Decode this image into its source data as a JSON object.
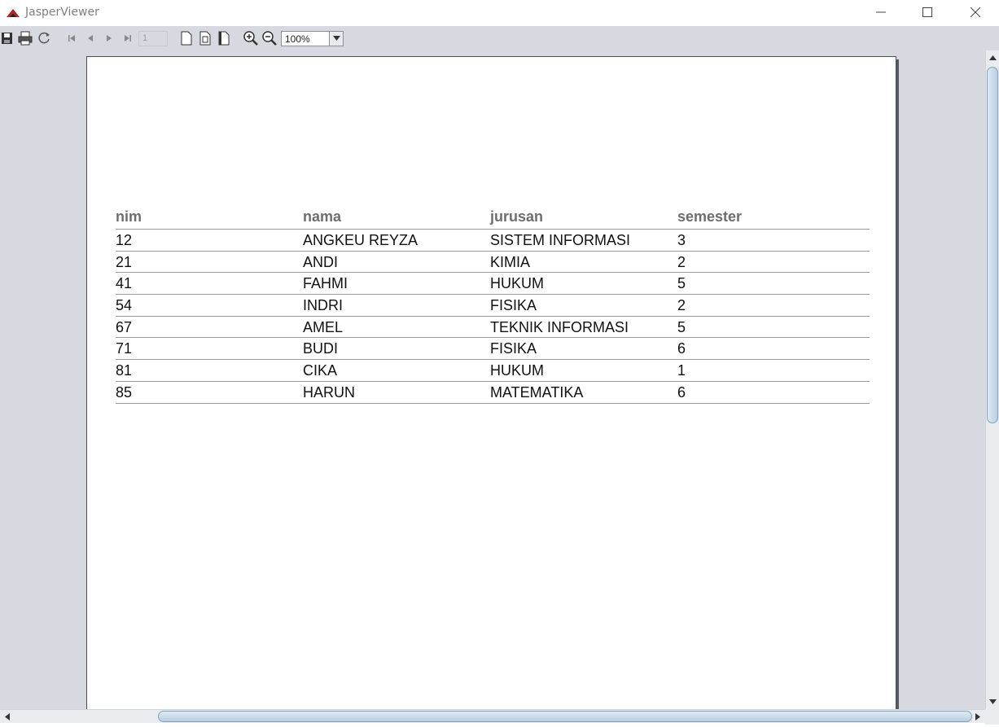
{
  "window": {
    "title": "JasperViewer",
    "icons": {
      "logo": "jasper-logo-icon",
      "minimize": "minimize-icon",
      "maximize": "maximize-icon",
      "close": "close-icon"
    }
  },
  "toolbar": {
    "buttons": [
      "save-icon",
      "print-icon",
      "reload-icon",
      "first-page-icon",
      "previous-page-icon",
      "next-page-icon",
      "last-page-icon",
      "actual-size-icon",
      "fit-page-icon",
      "fit-width-icon",
      "zoom-in-icon",
      "zoom-out-icon"
    ],
    "page_number": "1",
    "zoom": "100%"
  },
  "report": {
    "columns": [
      "nim",
      "nama",
      "jurusan",
      "semester"
    ],
    "rows": [
      [
        "12",
        "ANGKEU REYZA",
        "SISTEM INFORMASI",
        "3"
      ],
      [
        "21",
        "ANDI",
        "KIMIA",
        "2"
      ],
      [
        "41",
        "FAHMI",
        "HUKUM",
        "5"
      ],
      [
        "54",
        "INDRI",
        "FISIKA",
        "2"
      ],
      [
        "67",
        "AMEL",
        "TEKNIK INFORMASI",
        "5"
      ],
      [
        "71",
        "BUDI",
        "FISIKA",
        "6"
      ],
      [
        "81",
        "CIKA",
        "HUKUM",
        "1"
      ],
      [
        "85",
        "HARUN",
        "MATEMATIKA",
        "6"
      ]
    ]
  }
}
